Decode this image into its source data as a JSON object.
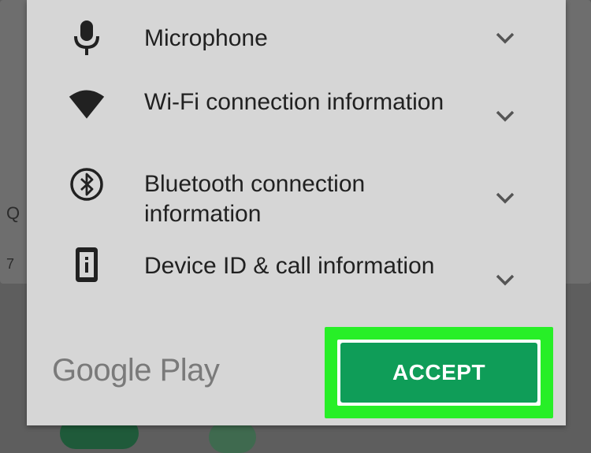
{
  "dialog": {
    "permissions": [
      {
        "label": "Microphone",
        "icon": "microphone-icon"
      },
      {
        "label": "Wi-Fi connection information",
        "icon": "wifi-icon"
      },
      {
        "label": "Bluetooth connection information",
        "icon": "bluetooth-icon"
      },
      {
        "label": "Device ID & call information",
        "icon": "device-info-icon"
      }
    ],
    "footer_logo": "Google Play",
    "accept_label": "ACCEPT"
  },
  "background": {
    "left_letter": "Q",
    "left_digit": "7"
  },
  "colors": {
    "dialog_bg": "#d6d6d6",
    "accept_green": "#0f9d58",
    "highlight": "#27ef27"
  }
}
